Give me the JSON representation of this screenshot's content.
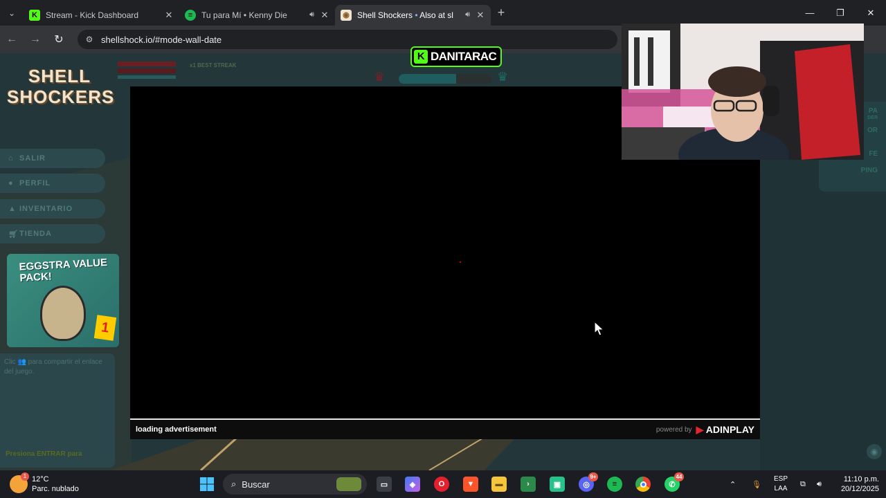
{
  "browser": {
    "tabs": [
      {
        "title": "Stream - Kick Dashboard",
        "favicon": "kick-icon",
        "color": "#53fc18",
        "active": false
      },
      {
        "title": "Tu para Mí • Kenny Die",
        "favicon": "spotify-icon",
        "color": "#1db954",
        "active": false
      },
      {
        "title": "Shell Shockers",
        "extra": "Also at sl",
        "favicon": "shellshockers-icon",
        "color": "#f0b030",
        "active": true
      }
    ],
    "url": "shellshock.io/#mode-wall-date"
  },
  "game": {
    "logo": "SHELL SHOCKERS",
    "streak_label": "x1 BEST STREAK",
    "menu": [
      {
        "label": "SALIR",
        "icon": "home-icon"
      },
      {
        "label": "PERFIL",
        "icon": "user-icon"
      },
      {
        "label": "INVENTARIO",
        "icon": "inventory-icon"
      },
      {
        "label": "TIENDA",
        "icon": "cart-icon"
      }
    ],
    "promo": {
      "title": "EGGSTRA VALUE PACK!",
      "price": "1"
    },
    "share_text": "Clic 👥 para compartir el enlace del juego.",
    "press_text": "Presiona ENTRAR para",
    "right_labels": [
      "PA",
      "DER",
      "OR",
      "FE",
      "PING"
    ],
    "health_level": 0.62
  },
  "ad": {
    "loading": "loading advertisement",
    "powered": "powered by",
    "brand": "ADINPLAY"
  },
  "overlay": {
    "streamer": "DANITARAC",
    "kick_color": "#53fc18"
  },
  "taskbar": {
    "weather_temp": "12°C",
    "weather_desc": "Parc. nublado",
    "weather_badge": "1",
    "search": "Buscar",
    "discord_badge": "9+",
    "whatsapp_badge": "44",
    "lang1": "ESP",
    "lang2": "LAA",
    "time": "11:10 p.m.",
    "date": "20/12/2025"
  }
}
